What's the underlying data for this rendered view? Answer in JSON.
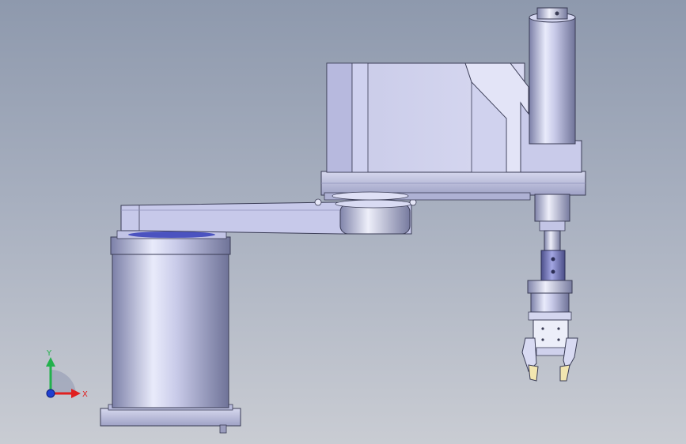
{
  "viewport": {
    "background_top": "#8e99ad",
    "background_bottom": "#c9ccd3"
  },
  "model": {
    "parts": [
      "base-column",
      "base-flange",
      "arm-link-1",
      "arm-link-2-housing",
      "z-axis-motor-column",
      "spline-shaft",
      "shaft-coupling",
      "gripper-body",
      "gripper-jaws"
    ]
  },
  "triad": {
    "y_label": "Y",
    "x_label": "X",
    "y_color": "#22b14c",
    "x_color": "#e02020",
    "z_color": "#2040d0"
  }
}
